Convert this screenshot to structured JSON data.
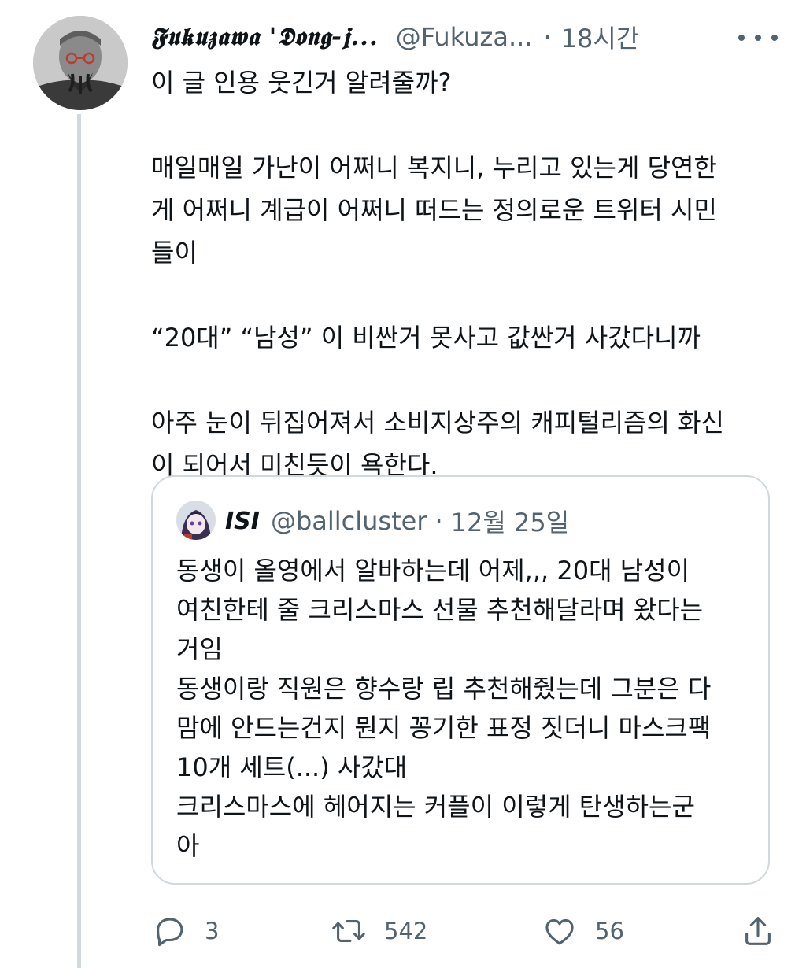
{
  "tweet": {
    "author": {
      "display_name": "𝕱𝖚𝖐𝖚𝖟𝖆𝖜𝖆 '𝕯𝖔𝖓𝖌-𝖏...",
      "handle": "@Fukuza...",
      "separator": "·",
      "time": "18시간"
    },
    "text_lines": [
      "이 글 인용 웃긴거 알려줄까?",
      "",
      "매일매일 가난이 어쩌니 복지니, 누리고 있는게 당연한",
      "게 어쩌니 계급이 어쩌니 떠드는 정의로운 트위터 시민",
      "들이",
      "",
      "“20대” “남성” 이 비싼거 못사고 값싼거 사갔다니까",
      "",
      "아주 눈이 뒤집어져서 소비지상주의 캐피털리즘의 화신",
      "이 되어서 미친듯이 욕한다."
    ],
    "quoted": {
      "display_name": "ISI",
      "handle": "@ballcluster",
      "separator": "·",
      "date": "12월 25일",
      "text_lines": [
        "동생이 올영에서 알바하는데 어제,,, 20대 남성이",
        "여친한테 줄 크리스마스 선물 추천해달라며 왔다는",
        "거임",
        "동생이랑 직원은 향수랑 립 추천해줬는데 그분은 다",
        "맘에 안드는건지 뭔지 꽁기한 표정 짓더니 마스크팩",
        "10개 세트(...) 사갔대",
        "크리스마스에 헤어지는 커플이 이렇게 탄생하는군",
        "아"
      ]
    },
    "actions": {
      "reply_count": "3",
      "retweet_count": "542",
      "like_count": "56"
    },
    "icons": {
      "reply": "reply-icon",
      "retweet": "retweet-icon",
      "like": "heart-icon",
      "share": "share-icon",
      "more": "more-options-icon"
    },
    "colors": {
      "text_primary": "#0f1419",
      "text_secondary": "#536471",
      "border": "#cfd9de"
    }
  }
}
